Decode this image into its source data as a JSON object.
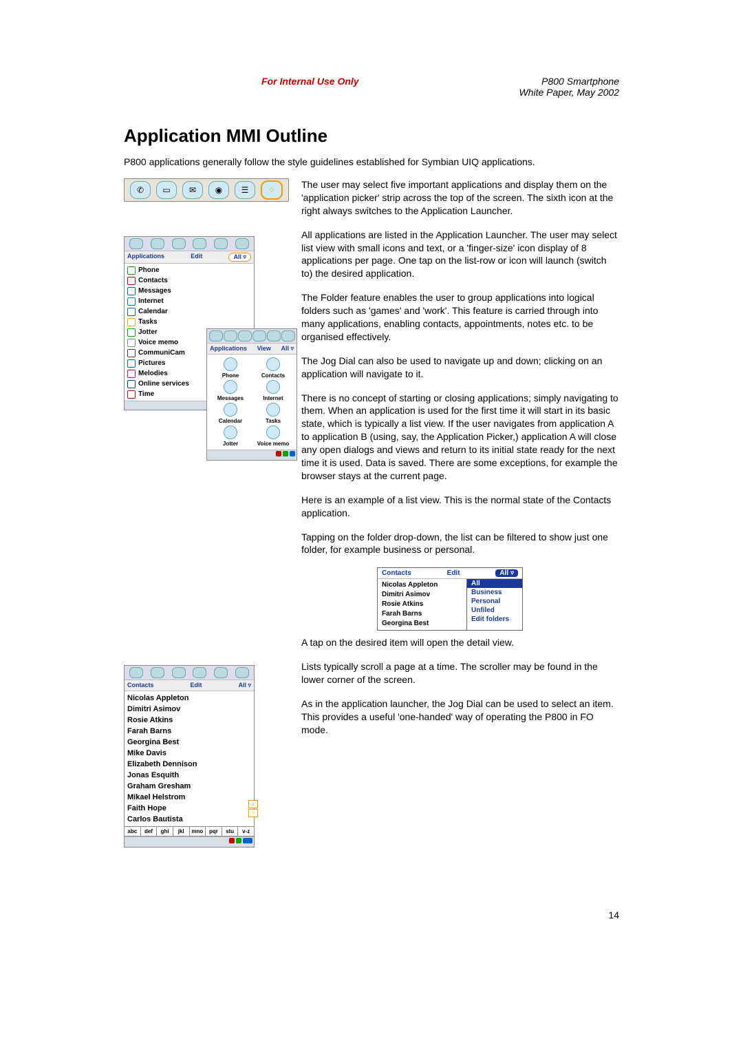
{
  "header": {
    "center": "For Internal Use Only",
    "right1": "P800 Smartphone",
    "right2": "White Paper, May 2002"
  },
  "title": "Application MMI Outline",
  "intro": "P800 applications generally follow the style guidelines established for Symbian UIQ applications.",
  "paras": {
    "p1": "The user may select five important applications and display them on the 'application picker' strip across the top of the screen. The sixth icon at the right always switches to the Application Launcher.",
    "p2": "All applications are listed in the Application Launcher. The user may select list view with small icons and text, or a 'finger-size' icon display of 8 applications per page. One tap on the list-row or icon will launch (switch to) the desired application.",
    "p3": "The Folder feature enables the user to group applications into logical folders such as 'games' and 'work'. This feature is carried through into many applications, enabling contacts, appointments, notes etc. to be organised effectively.",
    "p4": "The Jog Dial can also be used to navigate up and down; clicking on an application will navigate to it.",
    "p5": "There is no concept of starting or closing applications; simply navigating to them. When an application is used for the first time it will start in its basic state, which is typically a list view. If the user navigates from application A to application B (using, say, the Application Picker,) application A will close any open dialogs and views and return to its initial state ready for the next time it is used. Data is saved. There are some exceptions, for example the browser stays at the current page.",
    "p6": "Here is an example of a list view. This is the normal state of the Contacts application.",
    "p7": "Tapping on the folder drop-down, the list can be filtered to show just one folder, for example business or personal.",
    "p8": "A tap on the desired item will open the detail view.",
    "p9": "Lists typically scroll a page at a time. The scroller may be found in the lower corner of the screen.",
    "p10": "As in the application launcher, the Jog Dial can be used to select an item. This provides a useful 'one-handed' way of operating the P800 in FO mode."
  },
  "app_list_box": {
    "menu1": "Applications",
    "menu2": "Edit",
    "all": "All ▿",
    "items": [
      "Phone",
      "Contacts",
      "Messages",
      "Internet",
      "Calendar",
      "Tasks",
      "Jotter",
      "Voice memo",
      "CommuniCam",
      "Pictures",
      "Melodies",
      "Online services",
      "Time"
    ]
  },
  "launcher_box": {
    "menu1": "Applications",
    "menu2": "View",
    "all": "All ▿",
    "items": [
      "Phone",
      "Contacts",
      "Messages",
      "Internet",
      "Calendar",
      "Tasks",
      "Jotter",
      "Voice memo"
    ]
  },
  "contacts_box": {
    "menu1": "Contacts",
    "menu2": "Edit",
    "all": "All ▿",
    "names": [
      "Nicolas Appleton",
      "Dimitri Asimov",
      "Rosie Atkins",
      "Farah Barns",
      "Georgina Best",
      "Mike Davis",
      "Elizabeth Dennison",
      "Jonas Esquith",
      "Graham Gresham",
      "Mikael Helstrom",
      "Faith Hope",
      "Carlos Bautista"
    ],
    "alpha": [
      "abc",
      "def",
      "ghi",
      "jkl",
      "mno",
      "pqr",
      "stu",
      "v-z"
    ]
  },
  "folder_mini": {
    "menu1": "Contacts",
    "menu2": "Edit",
    "all": "All ▿",
    "names": [
      "Nicolas Appleton",
      "Dimitri Asimov",
      "Rosie Atkins",
      "Farah Barns",
      "Georgina Best"
    ],
    "options": [
      "All",
      "Business",
      "Personal",
      "Unfiled",
      "Edit folders"
    ]
  },
  "page_number": "14"
}
